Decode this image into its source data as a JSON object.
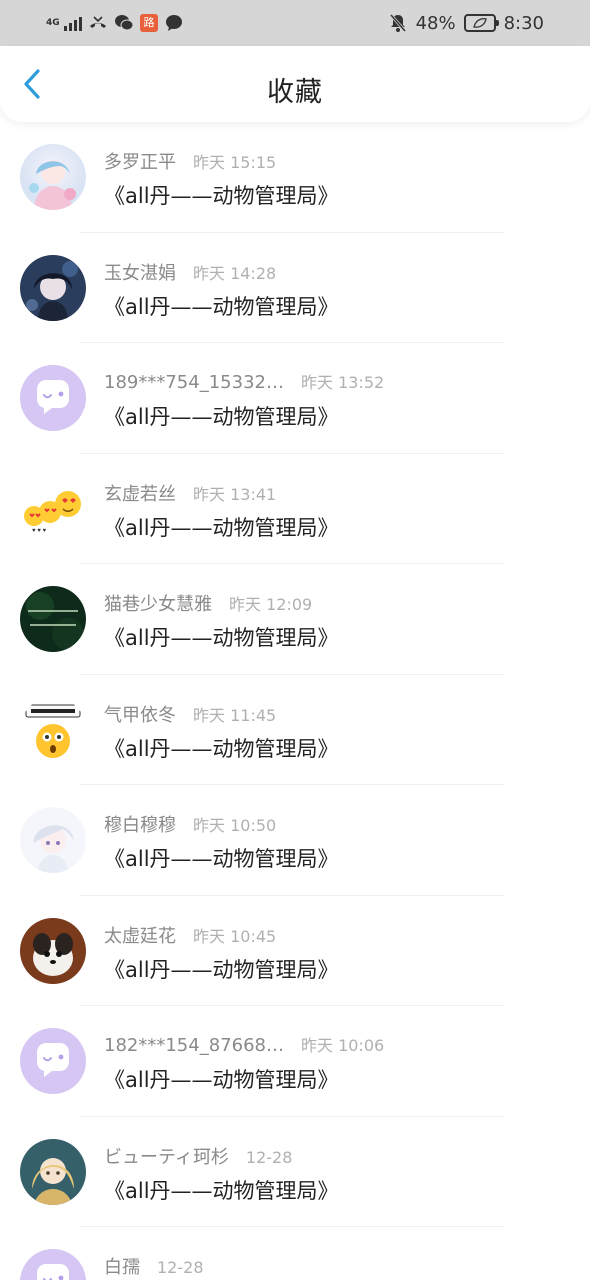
{
  "status_bar": {
    "network": "4G",
    "battery": "48%",
    "time": "8:30",
    "icons": [
      "signal-icon",
      "missed-call-icon",
      "wechat-icon",
      "app-badge-icon",
      "chat-bubble-icon",
      "mute-bell-icon",
      "battery-icon"
    ],
    "app_badge_text": "路"
  },
  "header": {
    "title": "收藏",
    "back_icon": "chevron-left-icon",
    "accent_color": "#2d9cdb"
  },
  "favorites": [
    {
      "name": "多罗正平",
      "time": "昨天 15:15",
      "title": "《all丹——动物管理局》",
      "avatar": "anime-girl-pastel"
    },
    {
      "name": "玉女湛娟",
      "time": "昨天 14:28",
      "title": "《all丹——动物管理局》",
      "avatar": "anime-boy-dark"
    },
    {
      "name": "189***754_15332…",
      "time": "昨天 13:52",
      "title": "《all丹——动物管理局》",
      "avatar": "default-chat"
    },
    {
      "name": "玄虚若丝",
      "time": "昨天 13:41",
      "title": "《all丹——动物管理局》",
      "avatar": "heart-eyes-emoji"
    },
    {
      "name": "猫巷少女慧雅",
      "time": "昨天 12:09",
      "title": "《all丹——动物管理局》",
      "avatar": "dark-green-text"
    },
    {
      "name": "气甲依冬",
      "time": "昨天 11:45",
      "title": "《all丹——动物管理局》",
      "avatar": "shocked-emoji"
    },
    {
      "name": "穆白穆穆",
      "time": "昨天 10:50",
      "title": "《all丹——动物管理局》",
      "avatar": "anime-white-hair"
    },
    {
      "name": "太虚廷花",
      "time": "昨天 10:45",
      "title": "《all丹——动物管理局》",
      "avatar": "puppy-photo"
    },
    {
      "name": "182***154_87668…",
      "time": "昨天 10:06",
      "title": "《all丹——动物管理局》",
      "avatar": "default-chat"
    },
    {
      "name": "ビューティ珂杉",
      "time": "12-28",
      "title": "《all丹——动物管理局》",
      "avatar": "anime-golden-hair"
    },
    {
      "name": "白孺",
      "time": "12-28",
      "title": "",
      "avatar": "default-chat"
    }
  ],
  "colors": {
    "status_bar_bg": "#d6d6d6",
    "default_avatar": "#d5c6f3",
    "name_text": "#8a8a8a",
    "time_text": "#b0b0b0"
  }
}
